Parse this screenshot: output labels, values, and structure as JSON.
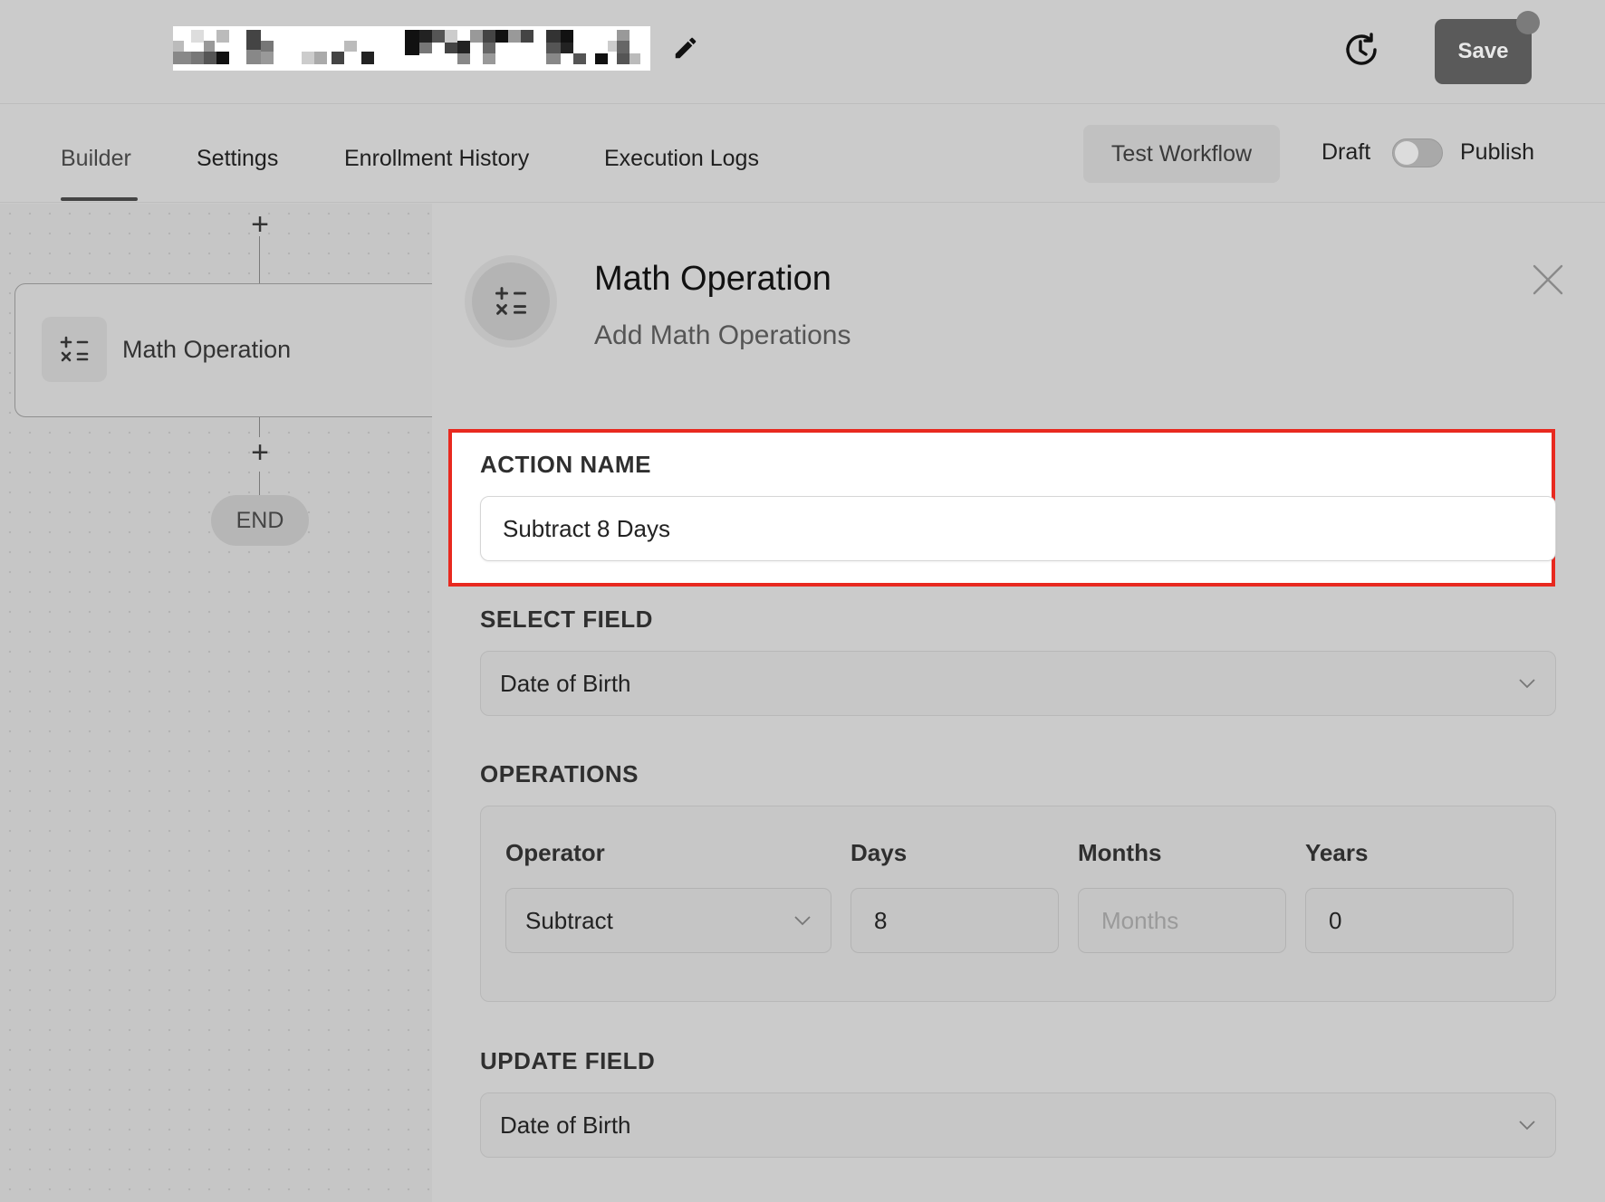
{
  "header": {
    "save_label": "Save"
  },
  "tabs": [
    {
      "label": "Builder",
      "active": true
    },
    {
      "label": "Settings"
    },
    {
      "label": "Enrollment History"
    },
    {
      "label": "Execution Logs"
    }
  ],
  "toolbar": {
    "test_workflow_label": "Test Workflow",
    "draft_label": "Draft",
    "publish_label": "Publish",
    "publish_toggle_on": false
  },
  "canvas": {
    "node_label": "Math Operation",
    "end_label": "END"
  },
  "panel": {
    "title": "Math Operation",
    "subtitle": "Add Math Operations",
    "action_name": {
      "label": "ACTION NAME",
      "value": "Subtract 8 Days"
    },
    "select_field": {
      "label": "SELECT FIELD",
      "value": "Date of Birth"
    },
    "operations": {
      "label": "OPERATIONS",
      "columns": [
        "Operator",
        "Days",
        "Months",
        "Years"
      ],
      "operator_value": "Subtract",
      "days_value": "8",
      "months_placeholder": "Months",
      "years_value": "0"
    },
    "update_field": {
      "label": "UPDATE FIELD",
      "value": "Date of Birth"
    }
  },
  "colors": {
    "highlight_border": "#e8291f",
    "save_button": "#5a5a5a"
  }
}
